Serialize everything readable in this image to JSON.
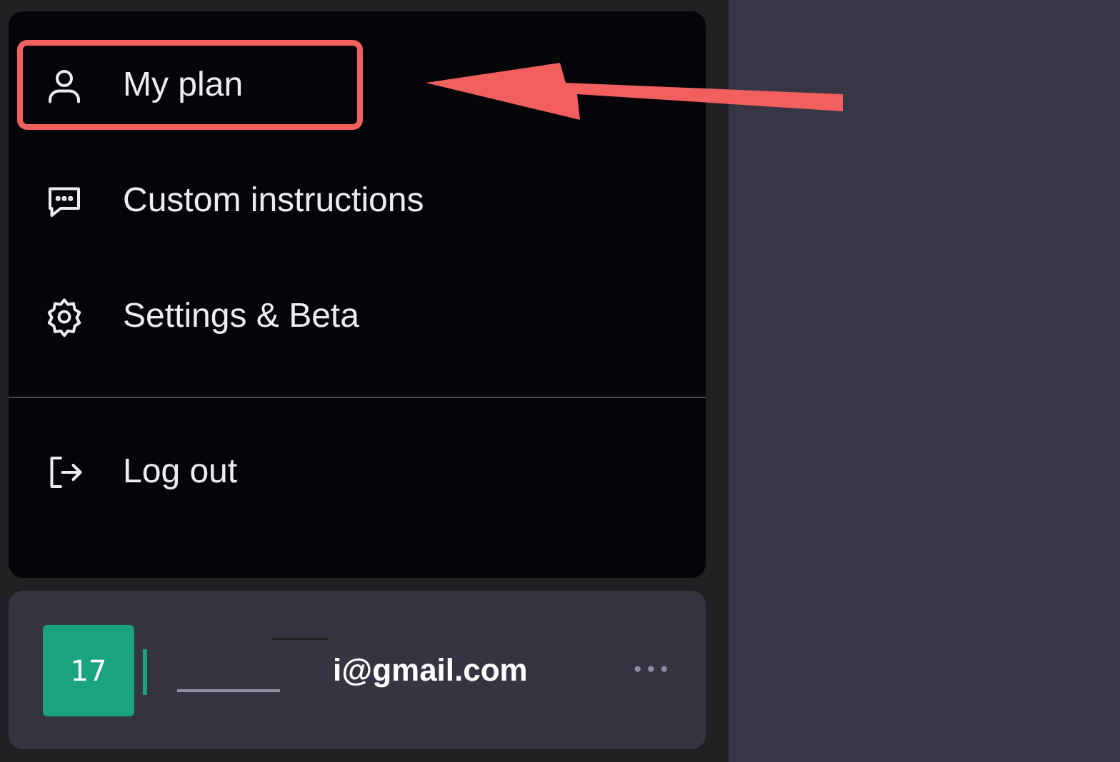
{
  "menu": {
    "sections": [
      {
        "items": [
          {
            "label": "My plan",
            "highlighted": true
          },
          {
            "label": "Custom instructions",
            "highlighted": false
          },
          {
            "label": "Settings & Beta",
            "highlighted": false
          }
        ]
      },
      {
        "items": [
          {
            "label": "Log out",
            "highlighted": false
          }
        ]
      }
    ]
  },
  "account": {
    "avatar_text": "17",
    "email": "i@gmail.com",
    "more": "•••"
  }
}
